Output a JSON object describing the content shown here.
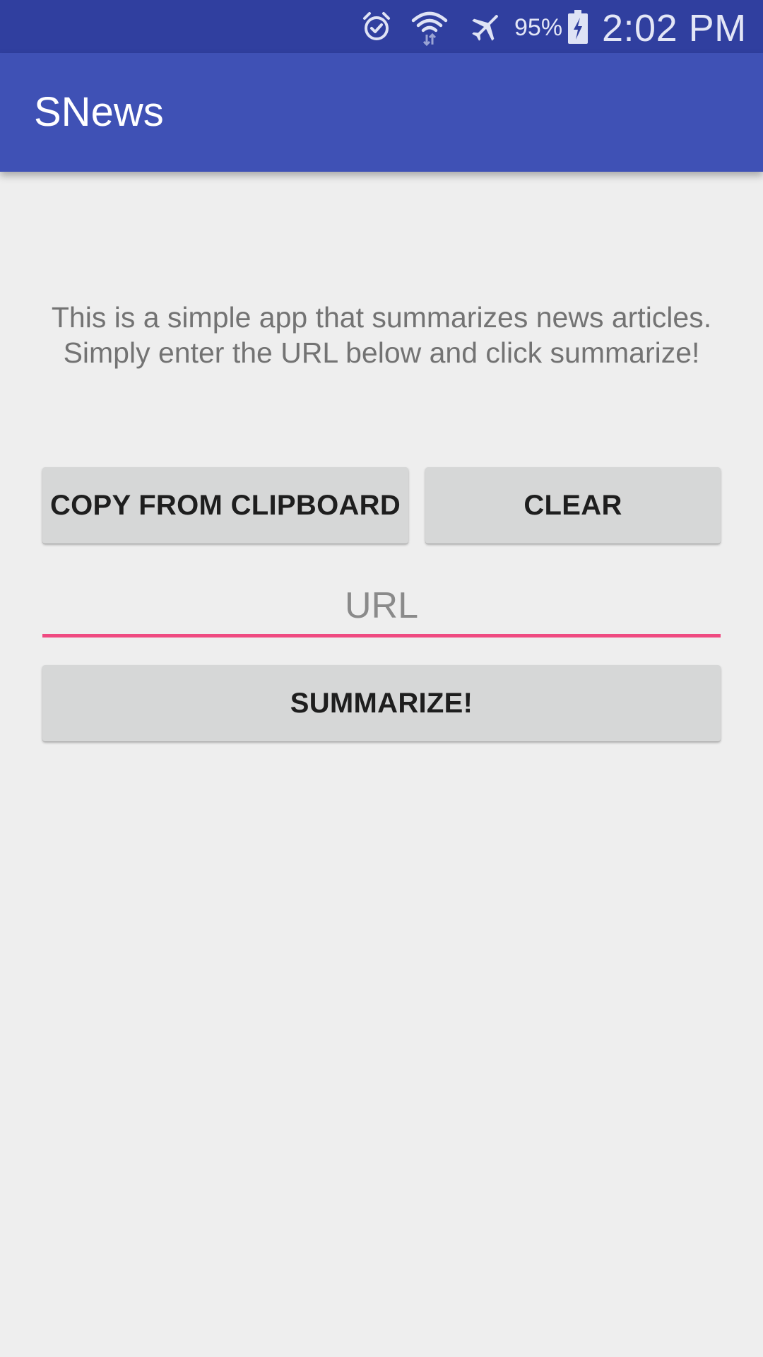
{
  "status_bar": {
    "battery_percent": "95%",
    "time": "2:02 PM",
    "icons": [
      "alarm-icon",
      "wifi-icon",
      "airplane-mode-icon",
      "battery-charging-icon"
    ]
  },
  "app_bar": {
    "title": "SNews"
  },
  "main": {
    "intro_text": "This is a simple app that summarizes news articles. Simply enter the URL below and click summarize!",
    "copy_button_label": "COPY FROM CLIPBOARD",
    "clear_button_label": "CLEAR",
    "url_placeholder": "URL",
    "url_value": "",
    "summarize_button_label": "SUMMARIZE!"
  },
  "colors": {
    "status_bar": "#303f9f",
    "app_bar": "#3f51b5",
    "accent": "#ef4a81",
    "background": "#eeeeee",
    "button": "#d6d7d7"
  }
}
